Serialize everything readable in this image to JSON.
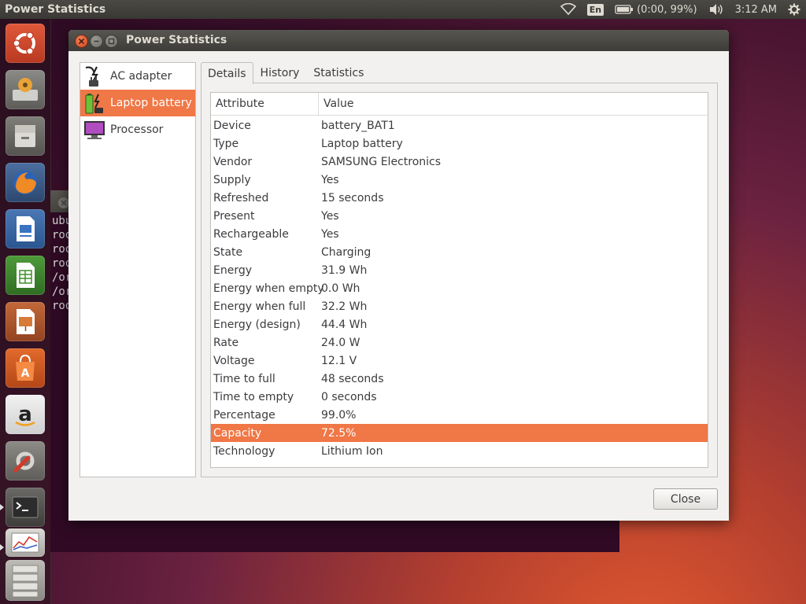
{
  "top_panel": {
    "app_title": "Power Statistics",
    "keyboard_layout": "En",
    "battery_status": "(0:00, 99%)",
    "clock": "3:12 AM"
  },
  "launcher": {
    "items": [
      {
        "name": "ubuntu-dash-icon"
      },
      {
        "name": "system-installer-icon"
      },
      {
        "name": "files-icon"
      },
      {
        "name": "firefox-icon"
      },
      {
        "name": "libreoffice-writer-icon"
      },
      {
        "name": "libreoffice-calc-icon"
      },
      {
        "name": "libreoffice-impress-icon"
      },
      {
        "name": "software-center-icon"
      },
      {
        "name": "amazon-icon"
      },
      {
        "name": "system-settings-icon"
      },
      {
        "name": "terminal-icon"
      },
      {
        "name": "power-statistics-icon"
      },
      {
        "name": "workspace-switcher-icon"
      }
    ]
  },
  "bg_terminal": {
    "lines": [
      "ubu",
      "roo",
      "roo",
      "roo",
      "/or",
      "/or",
      "roo"
    ]
  },
  "window": {
    "title": "Power Statistics",
    "devices": [
      {
        "label": "AC adapter",
        "icon": "ac-adapter-icon",
        "selected": false
      },
      {
        "label": "Laptop battery",
        "icon": "battery-icon",
        "selected": true
      },
      {
        "label": "Processor",
        "icon": "processor-icon",
        "selected": false
      }
    ],
    "tabs": [
      {
        "label": "Details",
        "active": true
      },
      {
        "label": "History",
        "active": false
      },
      {
        "label": "Statistics",
        "active": false
      }
    ],
    "table": {
      "columns": [
        "Attribute",
        "Value"
      ],
      "rows": [
        [
          "Device",
          "battery_BAT1"
        ],
        [
          "Type",
          "Laptop battery"
        ],
        [
          "Vendor",
          "SAMSUNG Electronics"
        ],
        [
          "Supply",
          "Yes"
        ],
        [
          "Refreshed",
          "15 seconds"
        ],
        [
          "Present",
          "Yes"
        ],
        [
          "Rechargeable",
          "Yes"
        ],
        [
          "State",
          "Charging"
        ],
        [
          "Energy",
          "31.9 Wh"
        ],
        [
          "Energy when empty",
          "0.0 Wh"
        ],
        [
          "Energy when full",
          "32.2 Wh"
        ],
        [
          "Energy (design)",
          "44.4 Wh"
        ],
        [
          "Rate",
          "24.0 W"
        ],
        [
          "Voltage",
          "12.1 V"
        ],
        [
          "Time to full",
          "48 seconds"
        ],
        [
          "Time to empty",
          "0 seconds"
        ],
        [
          "Percentage",
          "99.0%"
        ],
        [
          "Capacity",
          "72.5%"
        ],
        [
          "Technology",
          "Lithium Ion"
        ]
      ],
      "selected_row": 17
    },
    "close_label": "Close"
  },
  "colors": {
    "accent": "#f07746",
    "panel_bg": "#3c3b37",
    "window_bg": "#f2f1f0"
  }
}
